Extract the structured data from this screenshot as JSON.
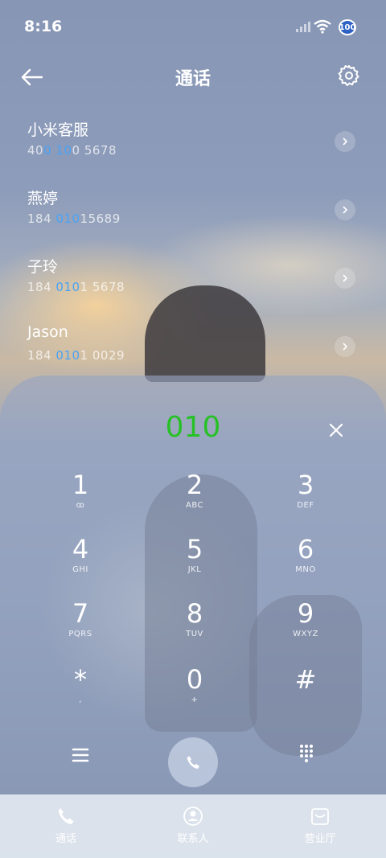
{
  "status_bar": {
    "time": "8:16",
    "battery": "100"
  },
  "header": {
    "title": "通话"
  },
  "contacts": [
    {
      "name": "小米客服",
      "number_parts": [
        "40",
        "0",
        " ",
        "10",
        "0 5678"
      ]
    },
    {
      "name": "燕婷",
      "number_parts": [
        "184 ",
        "010",
        "15689",
        "",
        ""
      ]
    },
    {
      "name": "子玲",
      "number_parts": [
        "184 ",
        "010",
        "1 5678",
        "",
        ""
      ]
    },
    {
      "name": "Jason",
      "number_parts": [
        "184 ",
        "010",
        "1 0029",
        "",
        ""
      ]
    }
  ],
  "dialer": {
    "entry": "010",
    "keys": [
      {
        "digit": "1",
        "letters": "ꝏ"
      },
      {
        "digit": "2",
        "letters": "ABC"
      },
      {
        "digit": "3",
        "letters": "DEF"
      },
      {
        "digit": "4",
        "letters": "GHI"
      },
      {
        "digit": "5",
        "letters": "JKL"
      },
      {
        "digit": "6",
        "letters": "MNO"
      },
      {
        "digit": "7",
        "letters": "PQRS"
      },
      {
        "digit": "8",
        "letters": "TUV"
      },
      {
        "digit": "9",
        "letters": "WXYZ"
      },
      {
        "digit": "*",
        "letters": ","
      },
      {
        "digit": "0",
        "letters": "+"
      },
      {
        "digit": "#",
        "letters": ""
      }
    ]
  },
  "bottom_nav": [
    {
      "label": "通话",
      "icon": "phone-icon",
      "active": true
    },
    {
      "label": "联系人",
      "icon": "person-icon",
      "active": false
    },
    {
      "label": "营业厅",
      "icon": "store-icon",
      "active": false
    }
  ],
  "colors": {
    "entry": "#27c127",
    "highlight": "#4aa3f5"
  }
}
